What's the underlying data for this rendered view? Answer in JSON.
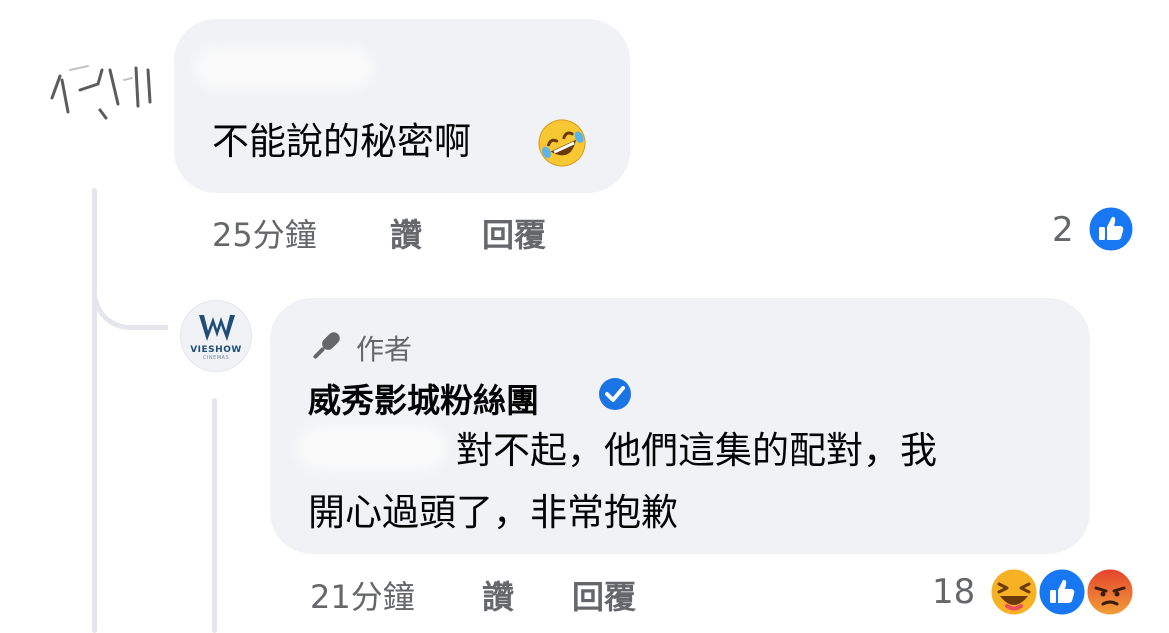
{
  "comment1": {
    "text": "不能說的秘密啊",
    "time": "25分鐘",
    "like_label": "讚",
    "reply_label": "回覆",
    "reaction_count": "2",
    "reaction_icons": [
      "like-icon"
    ]
  },
  "reply": {
    "badge_label": "作者",
    "author": "威秀影城粉絲團",
    "avatar_text": "VIESHOW",
    "avatar_subtext": "CINEMAS",
    "text_line1": "對不起，他們這集的配對，我",
    "text_line2": "開心過頭了，非常抱歉",
    "time": "21分鐘",
    "like_label": "讚",
    "reply_label": "回覆",
    "reaction_count": "18",
    "reaction_icons": [
      "haha-icon",
      "like-icon",
      "angry-icon"
    ]
  },
  "colors": {
    "bubble": "#f0f2f5",
    "meta_text": "#65676b",
    "like_blue": "#1877f2",
    "verified_blue": "#1b74e4",
    "haha_yellow": "#f7b125",
    "angry_orange": "#e9710f"
  }
}
